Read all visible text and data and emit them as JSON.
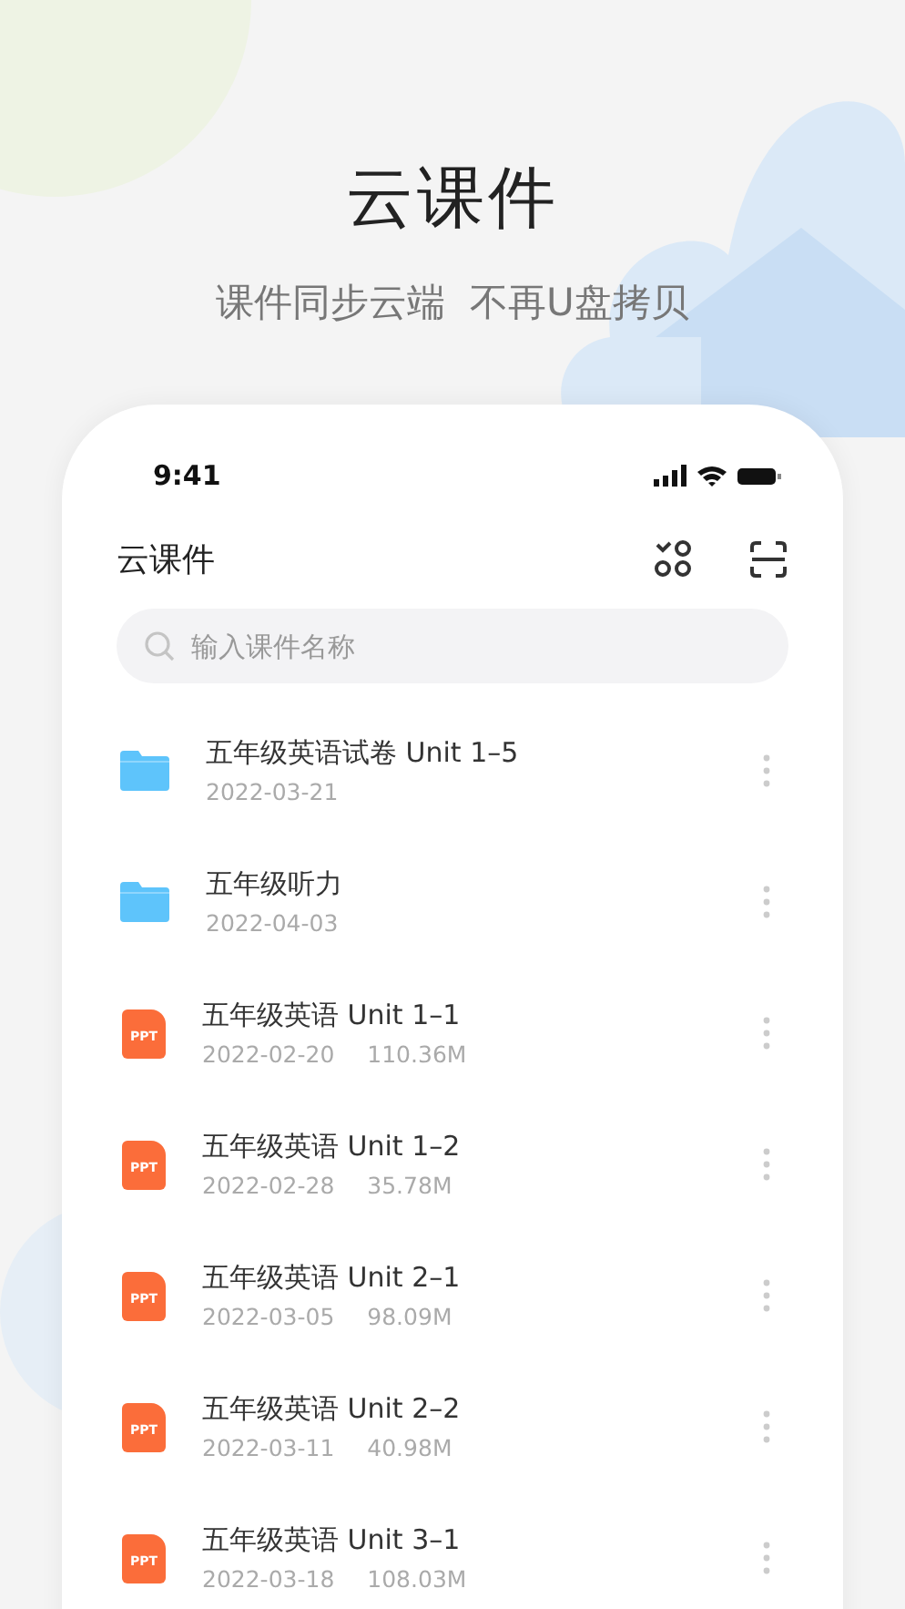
{
  "promo": {
    "title": "云课件",
    "subtitle": "课件同步云端  不再U盘拷贝"
  },
  "status_bar": {
    "time": "9:41"
  },
  "app_bar": {
    "title": "云课件"
  },
  "search": {
    "placeholder": "输入课件名称"
  },
  "files": [
    {
      "kind": "folder",
      "name": "五年级英语试卷 Unit 1–5",
      "date": "2022-03-21"
    },
    {
      "kind": "folder",
      "name": "五年级听力",
      "date": "2022-04-03"
    },
    {
      "kind": "ppt",
      "badge": "PPT",
      "name": "五年级英语 Unit 1–1",
      "date": "2022-02-20",
      "size": "110.36M"
    },
    {
      "kind": "ppt",
      "badge": "PPT",
      "name": "五年级英语 Unit 1–2",
      "date": "2022-02-28",
      "size": "35.78M"
    },
    {
      "kind": "ppt",
      "badge": "PPT",
      "name": "五年级英语 Unit 2–1",
      "date": "2022-03-05",
      "size": "98.09M"
    },
    {
      "kind": "ppt",
      "badge": "PPT",
      "name": "五年级英语 Unit 2–2",
      "date": "2022-03-11",
      "size": "40.98M"
    },
    {
      "kind": "ppt",
      "badge": "PPT",
      "name": "五年级英语 Unit 3–1",
      "date": "2022-03-18",
      "size": "108.03M"
    }
  ]
}
